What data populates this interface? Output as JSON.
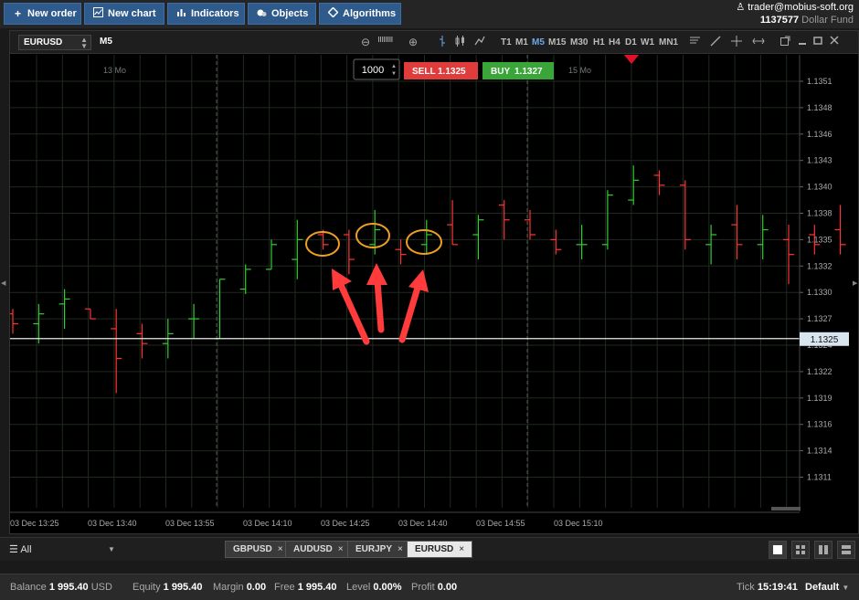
{
  "toolbar": {
    "new_order": "New order",
    "new_chart": "New chart",
    "indicators": "Indicators",
    "objects": "Objects",
    "algorithms": "Algorithms"
  },
  "account": {
    "user": "trader@mobius-soft.org",
    "number": "1137577",
    "fund": "Dollar Fund"
  },
  "chart": {
    "symbol": "EURUSD",
    "timeframe": "M5",
    "quantity": "1000",
    "sell_label": "SELL",
    "sell_price": "1.1325",
    "buy_label": "BUY",
    "buy_price": "1.1327",
    "timeframes": [
      "T1",
      "M1",
      "M5",
      "M15",
      "M30",
      "H1",
      "H4",
      "D1",
      "W1",
      "MN1"
    ],
    "active_timeframe": "M5",
    "day_labels": [
      "13 Mo",
      "15 Mo"
    ],
    "current_price_label": "1.1325",
    "colors": {
      "up": "#33cc33",
      "down": "#ff3333",
      "sell": "#e03c3c",
      "buy": "#3aa63a",
      "annotation": "#f0a020",
      "arrow": "#ff3b3b"
    }
  },
  "chart_data": {
    "type": "ohlc",
    "yaxis_ticks": [
      "1.1351",
      "1.1348",
      "1.1346",
      "1.1343",
      "1.1340",
      "1.1338",
      "1.1335",
      "1.1332",
      "1.1330",
      "1.1327",
      "1.1324",
      "1.1322",
      "1.1319",
      "1.1316",
      "1.1314",
      "1.1311"
    ],
    "xaxis_ticks": [
      "03 Dec 13:25",
      "03 Dec 13:40",
      "03 Dec 13:55",
      "03 Dec 14:10",
      "03 Dec 14:25",
      "03 Dec 14:40",
      "03 Dec 14:55",
      "03 Dec 15:10"
    ],
    "ylim": [
      1.13095,
      1.13525
    ],
    "current_price": 1.1325,
    "candles": [
      {
        "o": 1.13275,
        "h": 1.1328,
        "l": 1.13255,
        "c": 1.13265
      },
      {
        "o": 1.13265,
        "h": 1.13285,
        "l": 1.13245,
        "c": 1.13275
      },
      {
        "o": 1.13285,
        "h": 1.133,
        "l": 1.1326,
        "c": 1.1329
      },
      {
        "o": 1.1328,
        "h": 1.1328,
        "l": 1.1327,
        "c": 1.1327
      },
      {
        "o": 1.1326,
        "h": 1.1328,
        "l": 1.13195,
        "c": 1.1323
      },
      {
        "o": 1.13255,
        "h": 1.13265,
        "l": 1.1323,
        "c": 1.13245
      },
      {
        "o": 1.13245,
        "h": 1.1327,
        "l": 1.1323,
        "c": 1.13255
      },
      {
        "o": 1.1327,
        "h": 1.13285,
        "l": 1.1325,
        "c": 1.1327
      },
      {
        "o": 1.1325,
        "h": 1.1331,
        "l": 1.1325,
        "c": 1.1331
      },
      {
        "o": 1.133,
        "h": 1.13325,
        "l": 1.13295,
        "c": 1.1332
      },
      {
        "o": 1.1332,
        "h": 1.1335,
        "l": 1.1332,
        "c": 1.13345
      },
      {
        "o": 1.1333,
        "h": 1.1337,
        "l": 1.1331,
        "c": 1.1335
      },
      {
        "o": 1.13355,
        "h": 1.1336,
        "l": 1.1334,
        "c": 1.13345
      },
      {
        "o": 1.13355,
        "h": 1.1336,
        "l": 1.13315,
        "c": 1.1333
      },
      {
        "o": 1.13345,
        "h": 1.1338,
        "l": 1.13335,
        "c": 1.1336
      },
      {
        "o": 1.1334,
        "h": 1.1335,
        "l": 1.13325,
        "c": 1.13335
      },
      {
        "o": 1.13345,
        "h": 1.1337,
        "l": 1.13335,
        "c": 1.13355
      },
      {
        "o": 1.13365,
        "h": 1.1339,
        "l": 1.13345,
        "c": 1.13345
      },
      {
        "o": 1.13355,
        "h": 1.13375,
        "l": 1.1333,
        "c": 1.1337
      },
      {
        "o": 1.13385,
        "h": 1.1339,
        "l": 1.1335,
        "c": 1.1337
      },
      {
        "o": 1.1337,
        "h": 1.1338,
        "l": 1.1335,
        "c": 1.13355
      },
      {
        "o": 1.1335,
        "h": 1.1336,
        "l": 1.13335,
        "c": 1.1334
      },
      {
        "o": 1.13345,
        "h": 1.13365,
        "l": 1.1333,
        "c": 1.13345
      },
      {
        "o": 1.13345,
        "h": 1.134,
        "l": 1.1334,
        "c": 1.13395
      },
      {
        "o": 1.1339,
        "h": 1.13425,
        "l": 1.13385,
        "c": 1.1341
      },
      {
        "o": 1.13415,
        "h": 1.1342,
        "l": 1.13395,
        "c": 1.13405
      },
      {
        "o": 1.13405,
        "h": 1.1341,
        "l": 1.1334,
        "c": 1.1335
      },
      {
        "o": 1.13345,
        "h": 1.13365,
        "l": 1.13325,
        "c": 1.13355
      },
      {
        "o": 1.13365,
        "h": 1.13385,
        "l": 1.1333,
        "c": 1.13345
      },
      {
        "o": 1.13345,
        "h": 1.13375,
        "l": 1.1333,
        "c": 1.1336
      },
      {
        "o": 1.1335,
        "h": 1.13365,
        "l": 1.13305,
        "c": 1.13335
      },
      {
        "o": 1.13355,
        "h": 1.13365,
        "l": 1.13335,
        "c": 1.13345
      },
      {
        "o": 1.1336,
        "h": 1.13385,
        "l": 1.13335,
        "c": 1.13345
      },
      {
        "o": 1.13365,
        "h": 1.13385,
        "l": 1.1332,
        "c": 1.1334
      }
    ]
  },
  "tabs": {
    "filter": "All",
    "symbols": [
      "GBPUSD",
      "AUDUSD",
      "EURJPY",
      "EURUSD"
    ],
    "active": "EURUSD",
    "close": "×"
  },
  "status": {
    "balance_label": "Balance",
    "balance": "1 995.40",
    "currency": "USD",
    "equity_label": "Equity",
    "equity": "1 995.40",
    "margin_label": "Margin",
    "margin": "0.00",
    "free_label": "Free",
    "free": "1 995.40",
    "level_label": "Level",
    "level": "0.00%",
    "profit_label": "Profit",
    "profit": "0.00",
    "tick_label": "Tick",
    "tick": "15:19:41",
    "default_label": "Default"
  }
}
